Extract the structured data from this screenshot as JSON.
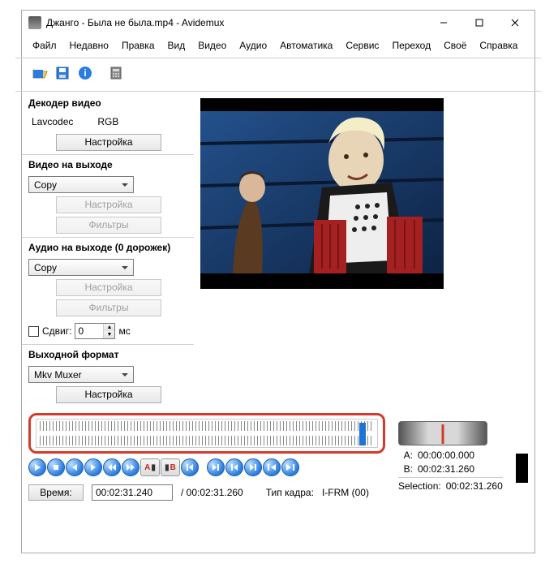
{
  "window": {
    "title": "Джанго - Была не была.mp4 - Avidemux"
  },
  "menu": {
    "file": "Файл",
    "recent": "Недавно",
    "edit": "Правка",
    "view": "Вид",
    "video": "Видео",
    "audio": "Аудио",
    "auto": "Автоматика",
    "service": "Сервис",
    "goto": "Переход",
    "own": "Своё",
    "help": "Справка"
  },
  "decoder": {
    "title": "Декодер видео",
    "codec": "Lavcodec",
    "format": "RGB",
    "configure": "Настройка"
  },
  "video_out": {
    "title": "Видео на выходе",
    "codec": "Copy",
    "configure": "Настройка",
    "filters": "Фильтры"
  },
  "audio_out": {
    "title": "Аудио на выходе (0 дорожек)",
    "codec": "Copy",
    "configure": "Настройка",
    "filters": "Фильтры"
  },
  "shift": {
    "label": "Сдвиг:",
    "value": "0",
    "unit": "мс"
  },
  "output_format": {
    "title": "Выходной формат",
    "muxer": "Mkv Muxer",
    "configure": "Настройка"
  },
  "markers": {
    "a_label": "A:",
    "a_value": "00:00:00.000",
    "b_label": "B:",
    "b_value": "00:02:31.260",
    "sel_label": "Selection:",
    "sel_value": "00:02:31.260"
  },
  "time": {
    "label": "Время:",
    "current": "00:02:31.240",
    "total": "/ 00:02:31.260",
    "frame_label": "Тип кадра:",
    "frame_type": "I-FRM (00)"
  },
  "transport_markers": {
    "a": "A",
    "b": "B"
  }
}
